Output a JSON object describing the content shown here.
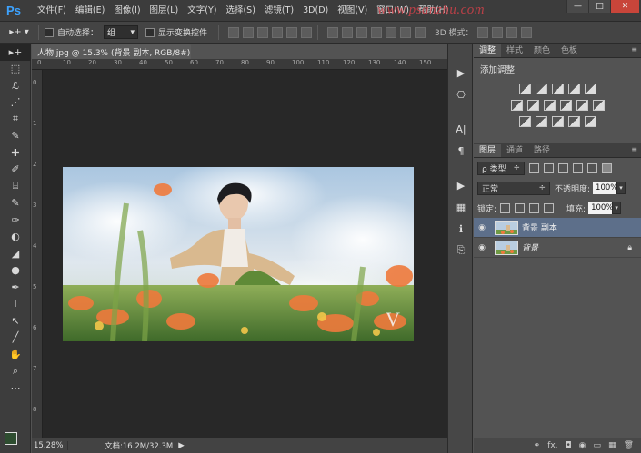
{
  "app": {
    "logo": "Ps",
    "watermark": "www.psanzhu.com"
  },
  "menu": [
    "文件(F)",
    "编辑(E)",
    "图像(I)",
    "图层(L)",
    "文字(Y)",
    "选择(S)",
    "滤镜(T)",
    "3D(D)",
    "视图(V)",
    "窗口(W)",
    "帮助(H)"
  ],
  "window": {
    "minimize": "—",
    "maximize": "□",
    "close": "✕"
  },
  "options": {
    "tool_icon": "▸+ ▾",
    "auto_select_label": "自动选择：",
    "auto_select_value": "组",
    "show_transform_label": "显示变换控件",
    "mode_3d_label": "3D 模式："
  },
  "document": {
    "tab_title": "人物.jpg @ 15.3% (背景 副本, RGB/8#) *",
    "close": "×",
    "zoom": "15.28%",
    "doc_info": "文档:16.2M/32.3M",
    "ruler_h": [
      "0",
      "10",
      "20",
      "30",
      "40",
      "50",
      "60",
      "70",
      "80",
      "90",
      "100",
      "110",
      "120",
      "130",
      "140",
      "150"
    ],
    "ruler_v": [
      "0",
      "1",
      "2",
      "3",
      "4",
      "5",
      "6",
      "7",
      "8"
    ],
    "image_mark": "V"
  },
  "tools": [
    "▸+",
    "⬚",
    "ℒ",
    "⋰",
    "⌗",
    "✎",
    "✚",
    "✐",
    "⌸",
    "✎",
    "✑",
    "◐",
    "◢",
    "●",
    "✒",
    "T",
    "↖",
    "╱",
    "✋",
    "⌕",
    "⋯"
  ],
  "colors": {
    "foreground": "#2e4d30",
    "background": "#f4f4f4"
  },
  "strip_icons": [
    "▶",
    "⎔",
    "A|",
    "¶",
    "▶",
    "▦",
    "ℹ",
    "⎘"
  ],
  "adjust_panel": {
    "tabs": [
      "调整",
      "样式",
      "颜色",
      "色板"
    ],
    "title": "添加调整"
  },
  "layers_panel": {
    "tabs": [
      "图层",
      "通道",
      "路径"
    ],
    "kind_label": "ρ 类型",
    "blend_mode": "正常",
    "opacity_label": "不透明度:",
    "opacity_value": "100%",
    "lock_label": "锁定:",
    "fill_label": "填充:",
    "fill_value": "100%",
    "layers": [
      {
        "name": "背景 副本",
        "visible": true,
        "selected": true
      },
      {
        "name": "背景",
        "visible": true,
        "selected": false,
        "locked": true
      }
    ],
    "footer_icons": [
      "⚭",
      "fx.",
      "◘",
      "◉",
      "▭",
      "▦",
      "🗑"
    ]
  }
}
